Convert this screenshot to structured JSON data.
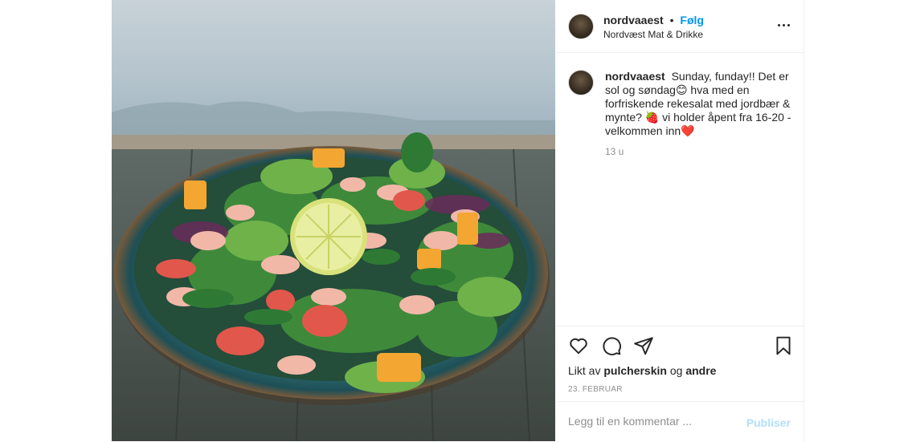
{
  "post": {
    "image_alt": "salad",
    "header": {
      "username": "nordvaaest",
      "separator": "•",
      "follow_label": "Følg",
      "location": "Nordvæst Mat & Drikke",
      "more_icon": "more-options-icon"
    },
    "caption": {
      "username": "nordvaaest",
      "text": "Sunday, funday!! Det er sol og søndag😊 hva med en forfriskende rekesalat med jordbær & mynte? 🍓 vi holder åpent fra 16-20 - velkommen inn❤️",
      "age": "13 u"
    },
    "actions": {
      "like_icon": "heart-icon",
      "comment_icon": "comment-icon",
      "share_icon": "share-icon",
      "save_icon": "bookmark-icon"
    },
    "likes": {
      "prefix": "Likt av",
      "user": "pulcherskin",
      "joiner": "og",
      "others": "andre"
    },
    "date": "23. FEBRUAR",
    "comment": {
      "placeholder": "Legg til en kommentar ...",
      "publish_label": "Publiser"
    }
  },
  "colors": {
    "link": "#0095f6",
    "publish_disabled": "#b2dffc",
    "muted": "#8e8e8e"
  }
}
